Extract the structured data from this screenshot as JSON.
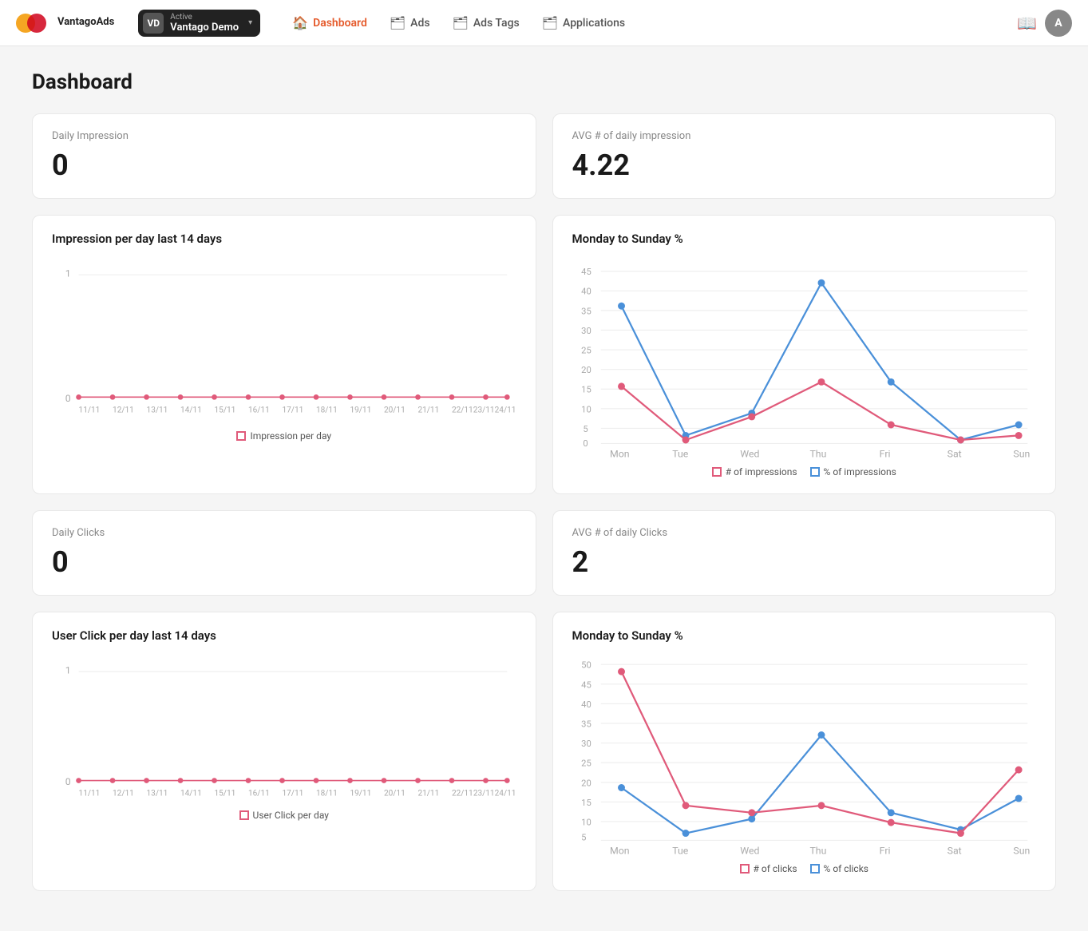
{
  "brand": {
    "name": "VantagoAds",
    "initials": "VD"
  },
  "account": {
    "status": "Active",
    "name": "Vantago Demo",
    "initials": "VD"
  },
  "nav": {
    "links": [
      {
        "id": "dashboard",
        "label": "Dashboard",
        "icon": "🏠",
        "active": true
      },
      {
        "id": "ads",
        "label": "Ads",
        "icon": "🗂"
      },
      {
        "id": "ads-tags",
        "label": "Ads Tags",
        "icon": "🗂"
      },
      {
        "id": "applications",
        "label": "Applications",
        "icon": "🗂"
      }
    ]
  },
  "page": {
    "title": "Dashboard"
  },
  "stats": {
    "daily_impression": {
      "label": "Daily Impression",
      "value": "0"
    },
    "avg_daily_impression": {
      "label": "AVG # of daily impression",
      "value": "4.22"
    },
    "daily_clicks": {
      "label": "Daily Clicks",
      "value": "0"
    },
    "avg_daily_clicks": {
      "label": "AVG # of daily Clicks",
      "value": "2"
    }
  },
  "charts": {
    "impressions_per_day": {
      "title": "Impression per day last 14 days",
      "legend": "Impression per day",
      "dates": [
        "11/11",
        "12/11",
        "13/11",
        "14/11",
        "15/11",
        "16/11",
        "17/11",
        "18/11",
        "19/11",
        "20/11",
        "21/11",
        "22/11",
        "23/11",
        "24/11"
      ],
      "values": [
        0,
        0,
        0,
        0,
        0,
        0,
        0,
        0,
        0,
        0,
        0,
        0,
        0,
        0
      ]
    },
    "monday_sunday_impressions": {
      "title": "Monday to Sunday %",
      "days": [
        "Mon",
        "Tue",
        "Wed",
        "Thu",
        "Fri",
        "Sat",
        "Sun"
      ],
      "series1": {
        "label": "# of impressions",
        "values": [
          15,
          1,
          7,
          16,
          5,
          1,
          2
        ]
      },
      "series2": {
        "label": "% of impressions",
        "values": [
          36,
          2,
          8,
          42,
          16,
          1,
          5
        ]
      }
    },
    "user_click_per_day": {
      "title": "User Click per day last 14 days",
      "legend": "User Click per day"
    },
    "monday_sunday_clicks": {
      "title": "Monday to Sunday %",
      "days": [
        "Mon",
        "Tue",
        "Wed",
        "Thu",
        "Fri",
        "Sat",
        "Sun"
      ],
      "series1": {
        "label": "# of clicks",
        "values": [
          48,
          10,
          8,
          10,
          5,
          2,
          20
        ]
      },
      "series2": {
        "label": "% of clicks",
        "values": [
          15,
          2,
          6,
          30,
          8,
          3,
          12
        ]
      }
    }
  },
  "user_avatar": "A"
}
